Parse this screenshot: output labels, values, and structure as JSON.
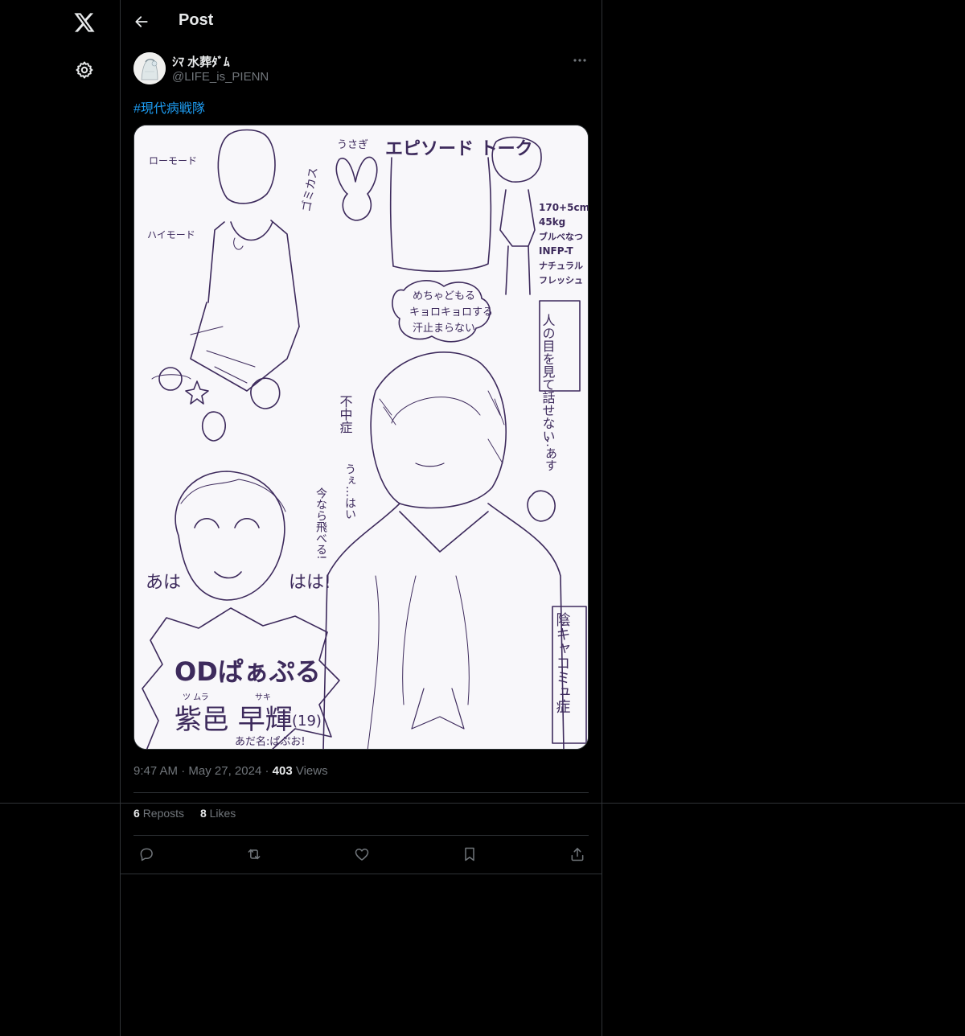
{
  "nav": {
    "logo_icon": "x-logo-icon",
    "settings_icon": "gear-icon"
  },
  "header": {
    "title": "Post",
    "back_icon": "arrow-left-icon"
  },
  "post": {
    "author": {
      "display_name": "ｼﾏ 水葬ﾀﾞﾑ",
      "handle": "@LIFE_is_PIENN"
    },
    "hashtag": "#現代病戦隊",
    "media": {
      "texts": {
        "top_title": "エピソード トーク",
        "usagi": "うさぎ",
        "lo_mode": "ローモード",
        "hi_mode": "ハイモード",
        "stats": [
          "170+5cm",
          "45kg",
          "ブルべなつ",
          "INFP-T",
          "ナチュラル",
          "フレッシュ"
        ],
        "gomikasu": "ゴミカス",
        "bubble": [
          "めちゃどもる",
          "キョロキョロする",
          "汗止まらない"
        ],
        "eyes": "人の目を見て話せない",
        "fuchu": "不中症",
        "inkya": "陰キャコミュ症",
        "ahaha": "あは",
        "haha": "はは!",
        "ima": "今なら飛べる!",
        "ue": "うぇ…はい",
        "asu": "…あす",
        "od": "ODぱぁぷる",
        "name": "紫邑 早輝",
        "age": "(19)",
        "furigana_sur": "ツ ムラ",
        "furigana_given": "サキ",
        "nickname": "あだ名:ぱぷお!"
      }
    },
    "time": "9:47 AM",
    "date": "May 27, 2024",
    "views_count": "403",
    "views_label": "Views",
    "reposts_count": "6",
    "reposts_label": "Reposts",
    "likes_count": "8",
    "likes_label": "Likes",
    "separator": "·"
  },
  "colors": {
    "accent": "#1d9bf0",
    "ink": "#3d2a5c",
    "muted": "#71767b",
    "border": "#2f3336"
  }
}
